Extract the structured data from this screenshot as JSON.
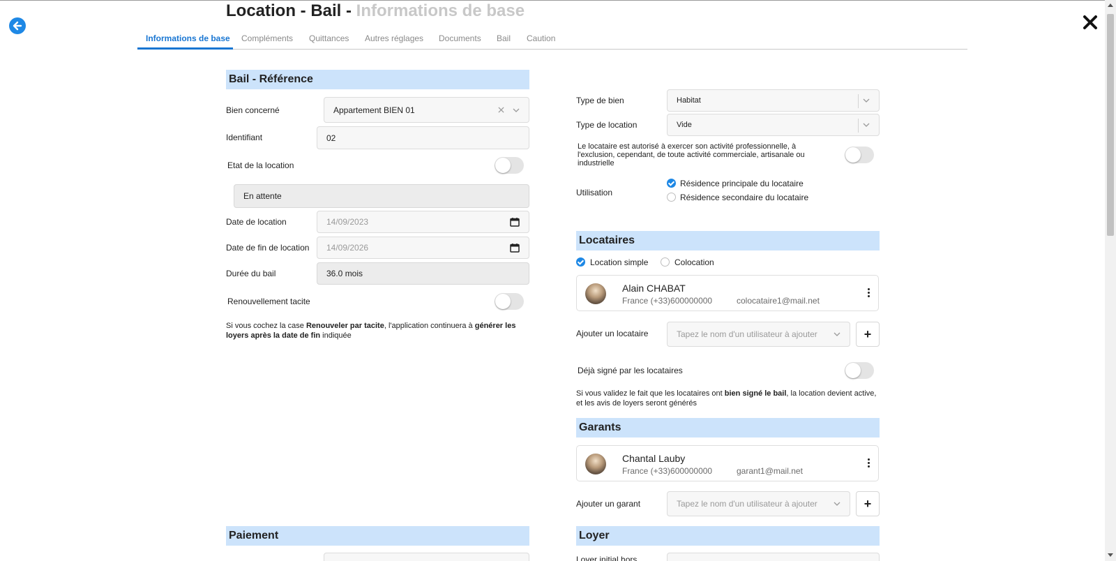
{
  "page": {
    "title_main": "Location - Bail - ",
    "title_sub": "Informations de base",
    "accent_color": "#1976d2"
  },
  "tabs": [
    {
      "label": "Informations de base",
      "active": true
    },
    {
      "label": "Compléments",
      "active": false
    },
    {
      "label": "Quittances",
      "active": false
    },
    {
      "label": "Autres réglages",
      "active": false
    },
    {
      "label": "Documents",
      "active": false
    },
    {
      "label": "Bail",
      "active": false
    },
    {
      "label": "Caution",
      "active": false
    }
  ],
  "bail": {
    "section_title": "Bail - Référence",
    "bien_label": "Bien concerné",
    "bien_value": "Appartement BIEN 01",
    "identifiant_label": "Identifiant",
    "identifiant_value": "02",
    "etat_label": "Etat de la location",
    "etat_toggle_on": false,
    "etat_value": "En attente",
    "date_label": "Date de location",
    "date_value": "14/09/2023",
    "date_fin_label": "Date de fin de location",
    "date_fin_value": "14/09/2026",
    "duree_label": "Durée du bail",
    "duree_value": "36.0 mois",
    "renouvellement_label": "Renouvellement tacite",
    "renouvellement_on": false,
    "note_1": "Si vous cochez la case ",
    "note_bold_1": "Renouveler par tacite",
    "note_2": ", l'application continuera à ",
    "note_bold_2": "générer les loyers après la date de fin",
    "note_3": " indiquée"
  },
  "right": {
    "type_bien_label": "Type de bien",
    "type_bien_value": "Habitat",
    "type_location_label": "Type de location",
    "type_location_value": "Vide",
    "activite_label": "Le locataire est autorisé à exercer son activité professionnelle, à l'exclusion, cependant, de toute activité commerciale, artisanale ou industrielle",
    "activite_on": false,
    "utilisation_label": "Utilisation",
    "utilisation_options": [
      "Résidence principale du locataire",
      "Résidence secondaire du locataire"
    ],
    "utilisation_selected": 0
  },
  "locataires": {
    "section_title": "Locataires",
    "mode_options": [
      "Location simple",
      "Colocation"
    ],
    "mode_selected": 0,
    "person": {
      "name": "Alain CHABAT",
      "phone": "France (+33)600000000",
      "email": "colocataire1@mail.net"
    },
    "add_label": "Ajouter un locataire",
    "add_placeholder": "Tapez le nom d'un utilisateur à ajouter",
    "add_button": "+",
    "signed_label": "Déjà signé par les locataires",
    "signed_on": false,
    "note_1": "Si vous validez le fait que les locataires ont ",
    "note_bold": "bien signé le bail",
    "note_2": ", la location devient active, et les avis de loyers seront générés"
  },
  "garants": {
    "section_title": "Garants",
    "person": {
      "name": "Chantal Lauby",
      "phone": "France (+33)600000000",
      "email": "garant1@mail.net"
    },
    "add_label": "Ajouter un garant",
    "add_placeholder": "Tapez le nom d'un utilisateur à ajouter",
    "add_button": "+"
  },
  "paiement": {
    "section_title": "Paiement"
  },
  "loyer": {
    "section_title": "Loyer",
    "initial_label": "Loyer initial hors"
  }
}
